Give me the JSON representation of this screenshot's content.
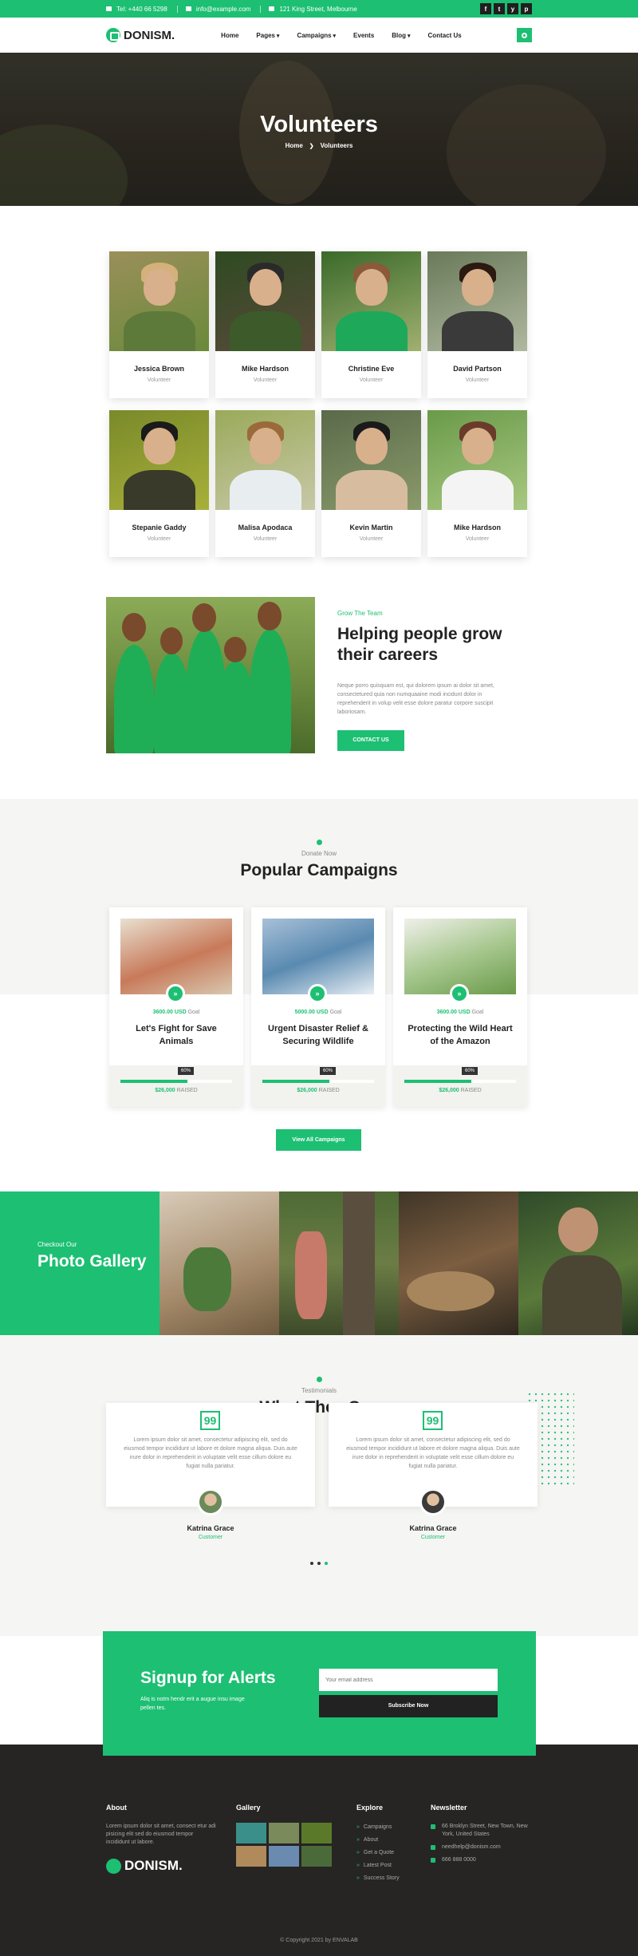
{
  "topbar": {
    "phone": "Tel: +440 66 5298",
    "email": "info@example.com",
    "address": "121 King Street, Melbourne",
    "socials": [
      "f",
      "t",
      "y",
      "p"
    ]
  },
  "nav": {
    "brand": "DONISM.",
    "items": [
      {
        "label": "Home",
        "dropdown": false
      },
      {
        "label": "Pages",
        "dropdown": true
      },
      {
        "label": "Campaigns",
        "dropdown": true
      },
      {
        "label": "Events",
        "dropdown": false
      },
      {
        "label": "Blog",
        "dropdown": true
      },
      {
        "label": "Contact Us",
        "dropdown": false
      }
    ]
  },
  "hero": {
    "title": "Volunteers",
    "crumb_home": "Home",
    "crumb_current": "Volunteers"
  },
  "volunteers": [
    {
      "name": "Jessica Brown",
      "role": "Volunteer"
    },
    {
      "name": "Mike Hardson",
      "role": "Volunteer"
    },
    {
      "name": "Christine Eve",
      "role": "Volunteer"
    },
    {
      "name": "David Partson",
      "role": "Volunteer"
    },
    {
      "name": "Stepanie Gaddy",
      "role": "Volunteer"
    },
    {
      "name": "Malisa Apodaca",
      "role": "Volunteer"
    },
    {
      "name": "Kevin Martin",
      "role": "Volunteer"
    },
    {
      "name": "Mike Hardson",
      "role": "Volunteer"
    }
  ],
  "help": {
    "kicker": "Grow The Team",
    "title": "Helping people grow their careers",
    "text": "Neque porro quisquam est, qui dolorem ipsum ai dolor sit amet, consectetured quia non numquaaine modi incidunt dolor in reprehenderit in volup velit esse dolore paratur corpore suscipit laboriosam.",
    "button": "CONTACT US"
  },
  "campaigns": {
    "kicker": "Donate Now",
    "title": "Popular Campaigns",
    "goal_label": "Goal",
    "raised_label": "RAISED",
    "items": [
      {
        "goal": "3600.00 USD",
        "title": "Let's Fight for Save Animals",
        "progress": 60,
        "progress_label": "60%",
        "raised": "$26,000"
      },
      {
        "goal": "5000.00 USD",
        "title": "Urgent Disaster Relief & Securing Wildlife",
        "progress": 60,
        "progress_label": "60%",
        "raised": "$26,000"
      },
      {
        "goal": "3600.00 USD",
        "title": "Protecting the Wild Heart of the Amazon",
        "progress": 60,
        "progress_label": "60%",
        "raised": "$26,000"
      }
    ],
    "button": "View All Campaigns"
  },
  "gallery": {
    "kicker": "Checkout Our",
    "title": "Photo Gallery"
  },
  "testimonials": {
    "kicker": "Testimonials",
    "title": "What They Say",
    "items": [
      {
        "text": "Lorem ipsum dolor sit amet, consectetur adipiscing elit, sed do eiusmod tempor incididunt ut labore et dolore magna aliqua. Duis aute irure dolor in reprehenderit in voluptate velit esse cillum dolore eu fugiat nulla pariatur.",
        "name": "Katrina Grace",
        "role": "Customer"
      },
      {
        "text": "Lorem ipsum dolor sit amet, consectetur adipiscing elit, sed do eiusmod tempor incididunt ut labore et dolore magna aliqua. Duis aute irure dolor in reprehenderit in voluptate velit esse cillum dolore eu fugiat nulla pariatur.",
        "name": "Katrina Grace",
        "role": "Customer"
      }
    ],
    "quote_glyph": "99"
  },
  "signup": {
    "title": "Signup for Alerts",
    "text": "Aliq is notm hendr erit a augue insu image pellen tes.",
    "placeholder": "Your email address",
    "button": "Subscribe Now"
  },
  "footer": {
    "about_title": "About",
    "about_text": "Lorem ipsum dolor sit amet, consect etur adi pisicing elit sed do eiusmod tempor incididunt ut labore.",
    "brand": "DONISM.",
    "gallery_title": "Gallery",
    "explore_title": "Explore",
    "explore_links": [
      "Campaigns",
      "About",
      "Get a Quote",
      "Latest Post",
      "Success Story"
    ],
    "newsletter_title": "Newsletter",
    "address": "66 Broklyn Street, New Town, New York, United States",
    "email": "needhelp@donism.com",
    "phone": "666 888 0000",
    "copyright": "© Copyright 2021 by ENVALAB"
  }
}
